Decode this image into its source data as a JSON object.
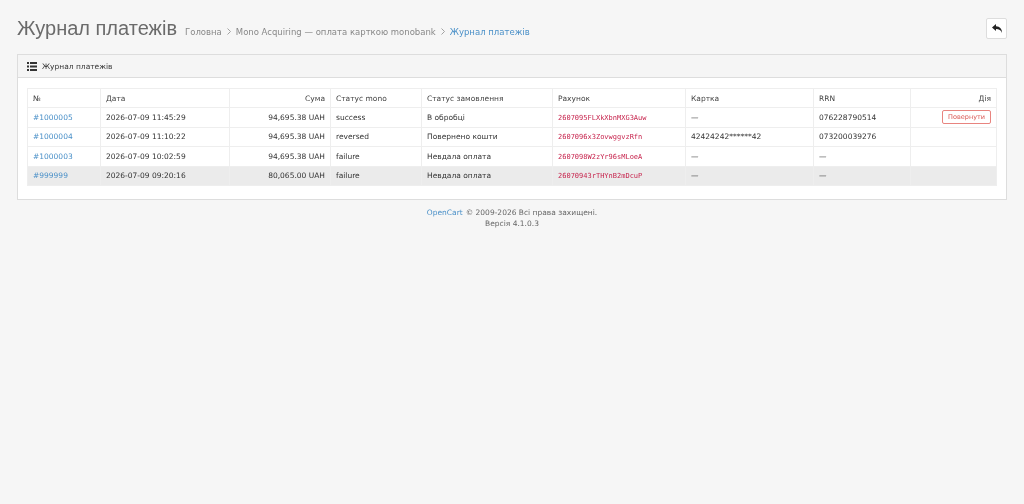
{
  "page_title": "Журнал платежів",
  "breadcrumbs": [
    {
      "label": "Головна",
      "active": false
    },
    {
      "label": "Mono Acquiring — оплата карткою monobank",
      "active": false
    },
    {
      "label": "Журнал платежів",
      "active": true
    }
  ],
  "panel": {
    "title": "Журнал платежів"
  },
  "table": {
    "columns": [
      "№",
      "Дата",
      "Сума",
      "Статус mono",
      "Статус замовлення",
      "Рахунок",
      "Картка",
      "RRN",
      "Дія"
    ],
    "rows": [
      {
        "order": "#1000005",
        "date": "2026-07-09 11:45:29",
        "amount": "94,695.38 UAH",
        "mono_status": "success",
        "order_status": "В обробці",
        "invoice": "2607095FLXkXbnMXG3Auw",
        "card": "—",
        "rrn": "076228790514",
        "action": "Повернути",
        "highlighted": false
      },
      {
        "order": "#1000004",
        "date": "2026-07-09 11:10:22",
        "amount": "94,695.38 UAH",
        "mono_status": "reversed",
        "order_status": "Повернено кошти",
        "invoice": "2607096x3ZovwggvzRfn",
        "card": "42424242******42",
        "rrn": "073200039276",
        "highlighted": false
      },
      {
        "order": "#1000003",
        "date": "2026-07-09 10:02:59",
        "amount": "94,695.38 UAH",
        "mono_status": "failure",
        "order_status": "Невдала оплата",
        "invoice": "2607098W2zYr96sMLoeA",
        "card": "—",
        "rrn": "—",
        "highlighted": false
      },
      {
        "order": "#999999",
        "date": "2026-07-09 09:20:16",
        "amount": "80,065.00 UAH",
        "mono_status": "failure",
        "order_status": "Невдала оплата",
        "invoice": "26070943rTHYnB2mDcuP",
        "card": "—",
        "rrn": "—",
        "highlighted": true
      }
    ]
  },
  "footer": {
    "link": "OpenCart",
    "text": "© 2009-2026 Всі права захищені.",
    "version": "Версія 4.1.0.3"
  }
}
